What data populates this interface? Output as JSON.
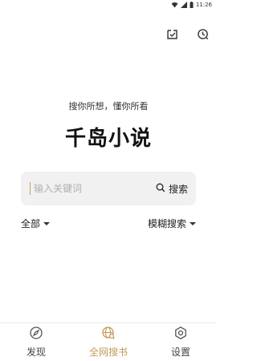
{
  "status_bar": {
    "time": "11:26"
  },
  "top_actions": {
    "checkin_icon": "check-calendar-icon",
    "history_icon": "clock-history-icon"
  },
  "slogan": "搜你所想，懂你所看",
  "app_title": "千岛小说",
  "search": {
    "placeholder": "输入关键词",
    "button_label": "搜索"
  },
  "filters": {
    "left_label": "全部",
    "right_label": "模糊搜索"
  },
  "bottom_nav": {
    "items": [
      {
        "label": "发现",
        "icon": "compass-icon",
        "active": false
      },
      {
        "label": "全网搜书",
        "icon": "globe-icon",
        "active": true
      },
      {
        "label": "设置",
        "icon": "gear-icon",
        "active": false
      }
    ]
  },
  "colors": {
    "accent": "#c49a5a",
    "search_bg": "#f1f1f1",
    "text": "#222222"
  }
}
